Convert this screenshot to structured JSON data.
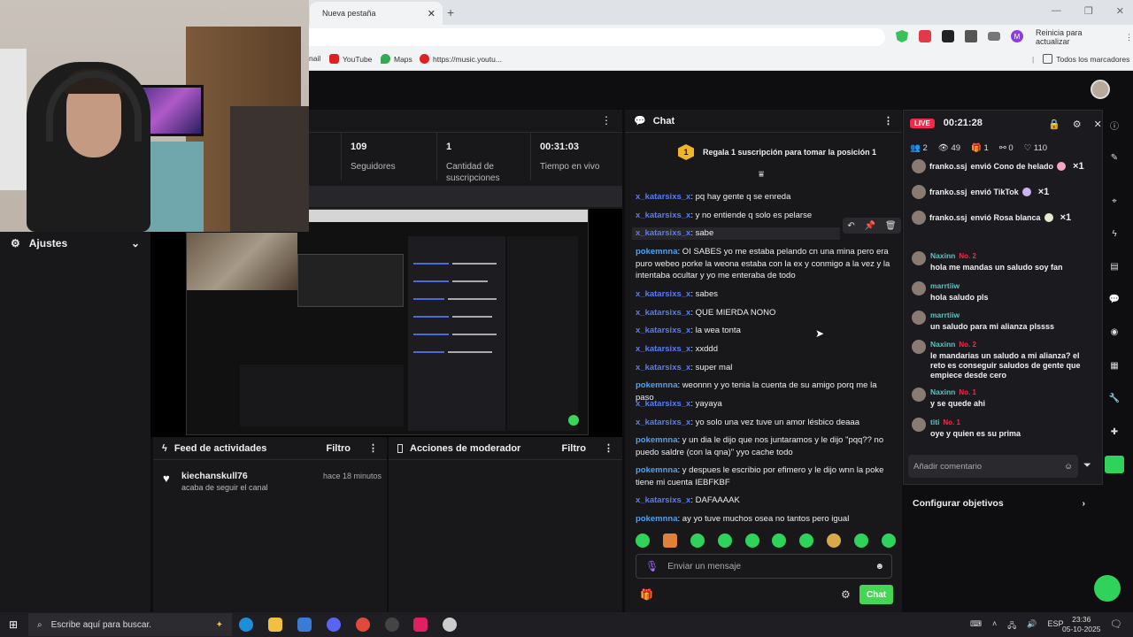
{
  "browser": {
    "tab_title": "Nueva pestaña",
    "update_label": "Reinicia para actualizar",
    "profile_letter": "M",
    "bookmarks": [
      "nail",
      "YouTube",
      "Maps",
      "https://music.youtu..."
    ],
    "all_bookmarks": "Todos los marcadores"
  },
  "sidebar": {
    "settings_label": "Ajustes"
  },
  "stats": [
    {
      "value": "",
      "label": ""
    },
    {
      "value": "109",
      "label": "Seguidores"
    },
    {
      "value": "1",
      "label": "Cantidad de suscripciones"
    },
    {
      "value": "00:31:03",
      "label": "Tiempo en vivo"
    }
  ],
  "feed": {
    "title": "Feed de actividades",
    "filter": "Filtro",
    "item_user": "kiechanskull76",
    "item_action": "acaba de seguir el canal",
    "item_time": "hace 18 minutos"
  },
  "mod": {
    "title": "Acciones de moderador",
    "filter": "Filtro"
  },
  "chat": {
    "title": "Chat",
    "banner_rank": "1",
    "banner_text": "Regala 1 suscripción para tomar la posición 1",
    "input_placeholder": "Enviar un mensaje",
    "send_label": "Chat",
    "messages": [
      {
        "user": "x_katarsixs_x",
        "text": "pq hay gente q se enreda"
      },
      {
        "user": "x_katarsixs_x",
        "text": "y no entiende q solo es pelarse"
      },
      {
        "user": "x_katarsixs_x",
        "text": "sabe"
      },
      {
        "user": "pokemnna",
        "text": "OI SABES yo me estaba pelando cn una mina pero era puro webeo porke la weona estaba con la ex y conmigo a la vez y la intentaba ocultar y yo me enteraba de todo"
      },
      {
        "user": "x_katarsixs_x",
        "text": "sabes"
      },
      {
        "user": "x_katarsixs_x",
        "text": "QUE MIERDA NONO"
      },
      {
        "user": "x_katarsixs_x",
        "text": "la wea tonta"
      },
      {
        "user": "x_katarsixs_x",
        "text": "xxddd"
      },
      {
        "user": "x_katarsixs_x",
        "text": "super mal"
      },
      {
        "user": "pokemnna",
        "text": "weonnn y yo tenia la cuenta de su amigo porq me la paso"
      },
      {
        "user": "x_katarsixs_x",
        "text": "yayaya"
      },
      {
        "user": "x_katarsixs_x",
        "text": "yo solo una vez tuve un amor lésbico deaaa"
      },
      {
        "user": "pokemnna",
        "text": "y un dia le dijo que nos juntaramos y le dijo \"pqq?? no puedo saldre (con la qna)\" yyo cache todo"
      },
      {
        "user": "pokemnna",
        "text": "y despues le escribio por efimero y le dijo wnn la poke tiene mi cuenta IEBFKBF"
      },
      {
        "user": "x_katarsixs_x",
        "text": "DAFAAAAK"
      },
      {
        "user": "pokemnna",
        "text": "ay yo tuve muchos osea no tantos pero igual"
      }
    ]
  },
  "live": {
    "badge": "LIVE",
    "time": "00:21:28",
    "stats": {
      "users": "2",
      "viewers": "49",
      "gifts": "1",
      "follows": "0",
      "likes": "110"
    },
    "gifts": [
      {
        "user": "franko.ssj",
        "text": "envió Cono de helado",
        "mult": "×1"
      },
      {
        "user": "franko.ssj",
        "text": "envió TikTok",
        "mult": "×1"
      },
      {
        "user": "franko.ssj",
        "text": "envió Rosa blanca",
        "mult": "×1"
      }
    ],
    "comments": [
      {
        "user": "Naxinn",
        "rank": "No. 2",
        "text": "hola me mandas un saludo soy fan"
      },
      {
        "user": "marrtiiw",
        "rank": "",
        "text": "hola saludo pls"
      },
      {
        "user": "marrtiiw",
        "rank": "",
        "text": "un saludo para mi alianza plssss"
      },
      {
        "user": "Naxinn",
        "rank": "No. 2",
        "text": "le mandarias un saludo a mi alianza? el reto es conseguir saludos de gente que empiece desde cero"
      },
      {
        "user": "Naxinn",
        "rank": "No. 1",
        "text": "y se quede ahi"
      },
      {
        "user": "titi",
        "rank": "No. 1",
        "text": "oye y quien es su prima"
      }
    ],
    "comment_placeholder": "Añadir comentario",
    "config_goals": "Configurar objetivos"
  },
  "taskbar": {
    "search_placeholder": "Escribe aquí para buscar.",
    "lang": "ESP",
    "time": "23:36",
    "date": "05-10-2025"
  },
  "colors": {
    "accent_green": "#45d653",
    "live_red": "#f2294b",
    "username_blue": "#5b7cf0"
  }
}
